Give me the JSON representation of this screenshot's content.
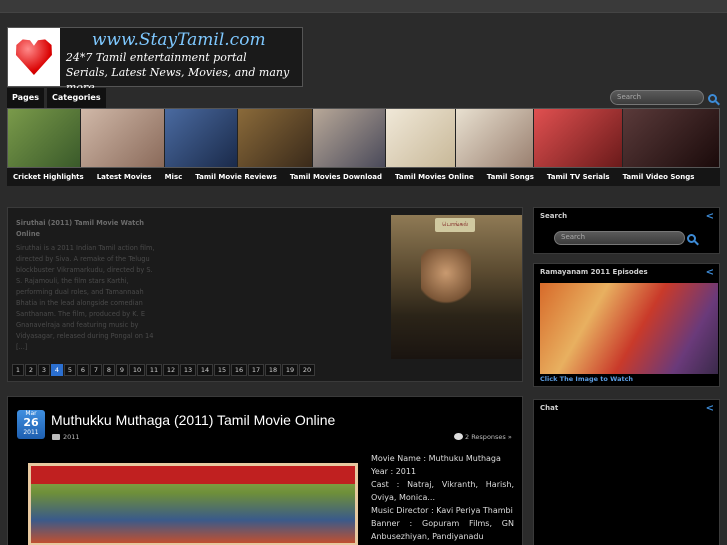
{
  "header": {
    "site_name": "www.StayTamil.com",
    "tagline_1": "24*7 Tamil entertainment portal",
    "tagline_2": "Serials, Latest News, Movies, and many more..."
  },
  "tabs": [
    "Pages",
    "Categories"
  ],
  "top_search": {
    "placeholder": "Search"
  },
  "category_nav": [
    "Cricket Highlights",
    "Latest Movies",
    "Misc",
    "Tamil Movie Reviews",
    "Tamil Movies Download",
    "Tamil Movies Online",
    "Tamil Songs",
    "Tamil TV Serials",
    "Tamil Video Songs"
  ],
  "banner_colors": [
    "#6a8a3a",
    "#b8a090",
    "#3a5a8a",
    "#6a4a2a",
    "#c0b0a0",
    "#e0d0b0",
    "#8a7a6a",
    "#c04040",
    "#3a2a2a"
  ],
  "slider": {
    "title": "Siruthai (2011) Tamil Movie Watch Online",
    "body": "Siruthai is a 2011 Indian Tamil action film, directed by Siva. A remake of the Telugu blockbuster Vikramarkudu, directed by S. S. Rajamouli, the film stars Karthi, performing dual roles, and Tamannaah Bhatia in the lead alongside comedian Santhanam. The film, produced by K. E Gnanavelraja and featuring music by Vidyasagar, released during Pongal on 14 [...]",
    "image_badge": "பொங்கல்",
    "pages": [
      "1",
      "2",
      "3",
      "4",
      "5",
      "6",
      "7",
      "8",
      "9",
      "10",
      "11",
      "12",
      "13",
      "14",
      "15",
      "16",
      "17",
      "18",
      "19",
      "20"
    ],
    "active_page": "4"
  },
  "post": {
    "date_month": "Mar",
    "date_day": "26",
    "date_year": "2011",
    "title": "Muthukku Muthaga (2011) Tamil Movie Online",
    "category": "2011",
    "responses": "2 Responses »",
    "info": [
      "Movie Name : Muthuku Muthaga",
      "Year : 2011",
      "Cast : Natraj, Vikranth, Harish, Oviya, Monica...",
      "Music Director : Kavi Periya Thambi",
      "Banner : Gopuram Films, GN Anbusezhiyan, Pandiyanadu"
    ]
  },
  "sidebar": {
    "search_title": "Search",
    "search_placeholder": "Search",
    "rama_title": "Ramayanam 2011 Episodes",
    "rama_caption": "Click The Image to Watch",
    "chat_title": "Chat"
  }
}
